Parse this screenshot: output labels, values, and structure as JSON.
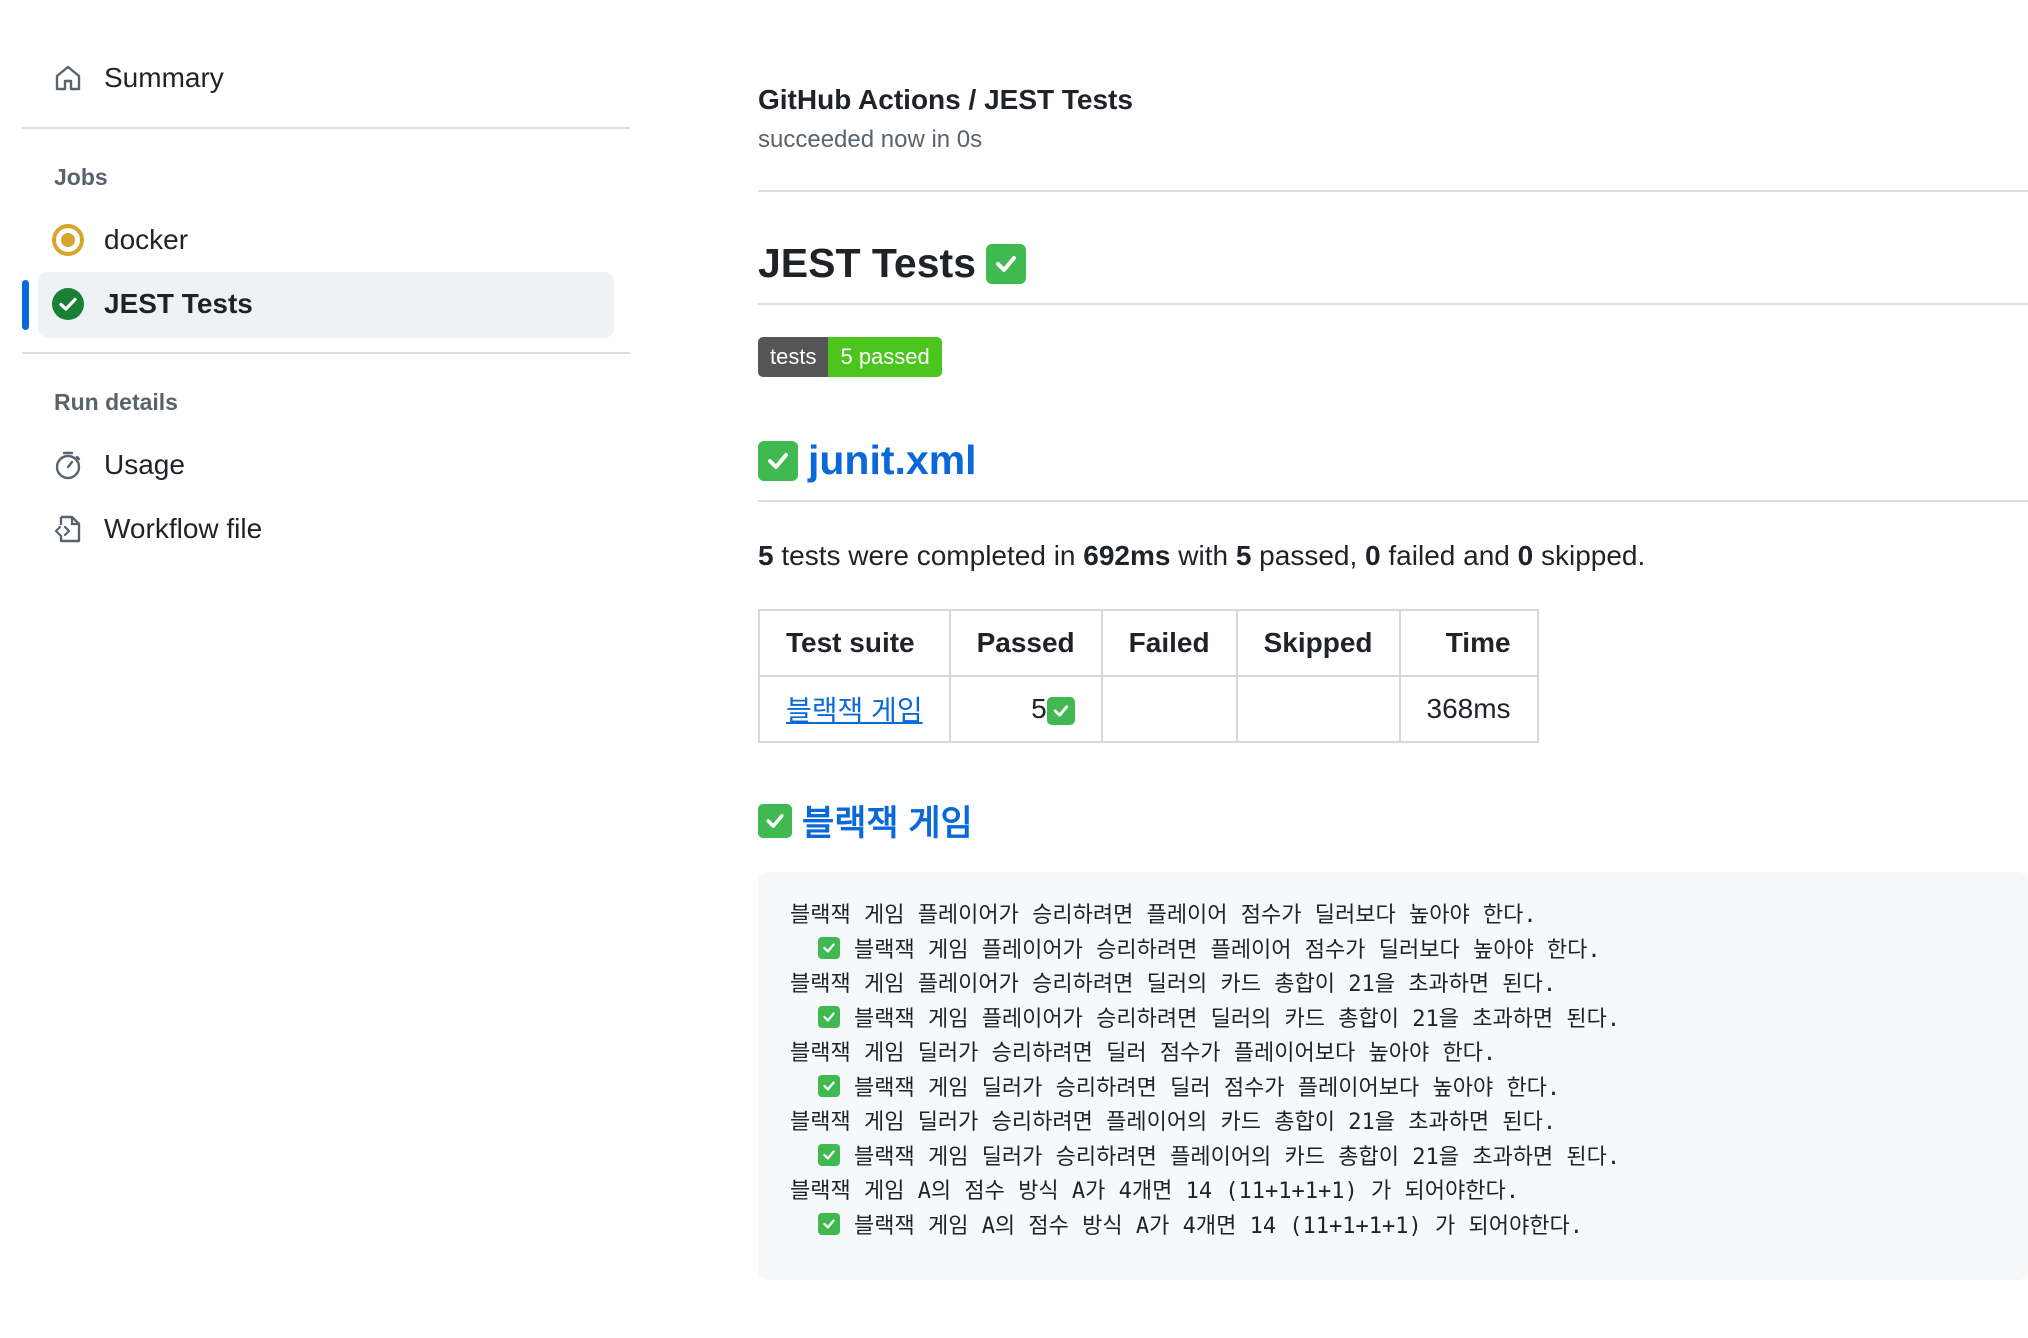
{
  "sidebar": {
    "summary_label": "Summary",
    "jobs_heading": "Jobs",
    "jobs": [
      {
        "label": "docker",
        "status": "in-progress",
        "status_color": "#d4a72c"
      },
      {
        "label": "JEST Tests",
        "status": "success",
        "status_color": "#1a7f37"
      }
    ],
    "run_details_heading": "Run details",
    "usage_label": "Usage",
    "workflow_label": "Workflow file"
  },
  "header": {
    "title": "GitHub Actions / JEST Tests",
    "subtitle": "succeeded now in 0s"
  },
  "report": {
    "title": "JEST Tests",
    "badge_left": "tests",
    "badge_right": "5 passed",
    "file_title": "junit.xml",
    "summary": {
      "count": "5",
      "text1": " tests were completed in ",
      "time": "692ms",
      "text2": " with ",
      "passed": "5",
      "text3": " passed, ",
      "failed": "0",
      "text4": " failed and ",
      "skipped": "0",
      "text5": " skipped."
    },
    "table": {
      "headers": [
        "Test suite",
        "Passed",
        "Failed",
        "Skipped",
        "Time"
      ],
      "rows": [
        {
          "suite": "블랙잭 게임",
          "passed": "5",
          "failed": "",
          "skipped": "",
          "time": "368ms"
        }
      ]
    },
    "suite_title": "블랙잭 게임",
    "code_lines": [
      "블랙잭 게임 플레이어가 승리하려면 플레이어 점수가 딜러보다 높아야 한다.",
      "블랙잭 게임 플레이어가 승리하려면 플레이어 점수가 딜러보다 높아야 한다.",
      "블랙잭 게임 플레이어가 승리하려면 딜러의 카드 총합이 21을 초과하면 된다.",
      "블랙잭 게임 플레이어가 승리하려면 딜러의 카드 총합이 21을 초과하면 된다.",
      "블랙잭 게임 딜러가 승리하려면 딜러 점수가 플레이어보다 높아야 한다.",
      "블랙잭 게임 딜러가 승리하려면 딜러 점수가 플레이어보다 높아야 한다.",
      "블랙잭 게임 딜러가 승리하려면 플레이어의 카드 총합이 21을 초과하면 된다.",
      "블랙잭 게임 딜러가 승리하려면 플레이어의 카드 총합이 21을 초과하면 된다.",
      "블랙잭 게임 A의 점수 방식 A가 4개면 14 (11+1+1+1) 가 되어야한다.",
      "블랙잭 게임 A의 점수 방식 A가 4개면 14 (11+1+1+1) 가 되어야한다."
    ]
  },
  "colors": {
    "accent": "#0969da",
    "success": "#3fb950",
    "badge_green": "#4cc61e",
    "badge_gray": "#555555"
  }
}
